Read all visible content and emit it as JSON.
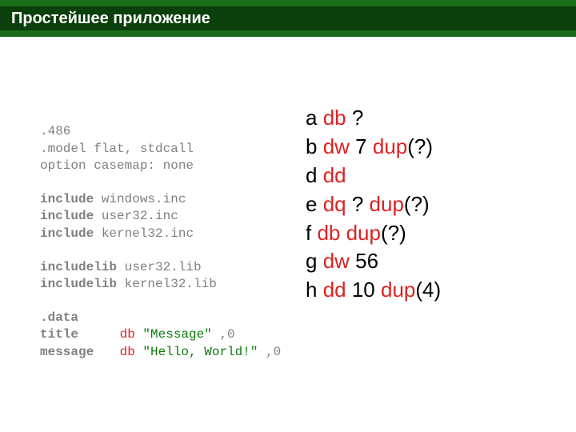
{
  "slide": {
    "title": "Простейшее приложение"
  },
  "left": {
    "l1": ".486",
    "l2": ".model flat, stdcall",
    "l3": "option casemap: none",
    "inc_kw": "include",
    "inc1": " windows.inc",
    "inc2": " user32.inc",
    "inc3": " kernel32.inc",
    "inclib_kw": "includelib",
    "inclib1": " user32.lib",
    "inclib2": " kernel32.lib",
    "data_section": ".data",
    "def1_name": "title",
    "def1_type": "db",
    "def1_str": "\"Message\"",
    "def1_tail": ",0",
    "def2_name": "message",
    "def2_type": "db",
    "def2_str": "\"Hello, World!\"",
    "def2_tail": ",0"
  },
  "right": {
    "a0": "a ",
    "a1": "db",
    "a2": " ?",
    "b0": "b ",
    "b1": "dw",
    "b2": " 7 ",
    "b3": "dup",
    "b4": "(?)",
    "d0": "d ",
    "d1": "dd",
    "e0": "e ",
    "e1": "dq",
    "e2": " ? ",
    "e3": "dup",
    "e4": "(?)",
    "f0": "f ",
    "f1": "db dup",
    "f2": "(?)",
    "g0": "g ",
    "g1": "dw",
    "g2": " 56",
    "h0": "h ",
    "h1": "dd",
    "h2": " 10 ",
    "h3": "dup",
    "h4": "(4)"
  }
}
